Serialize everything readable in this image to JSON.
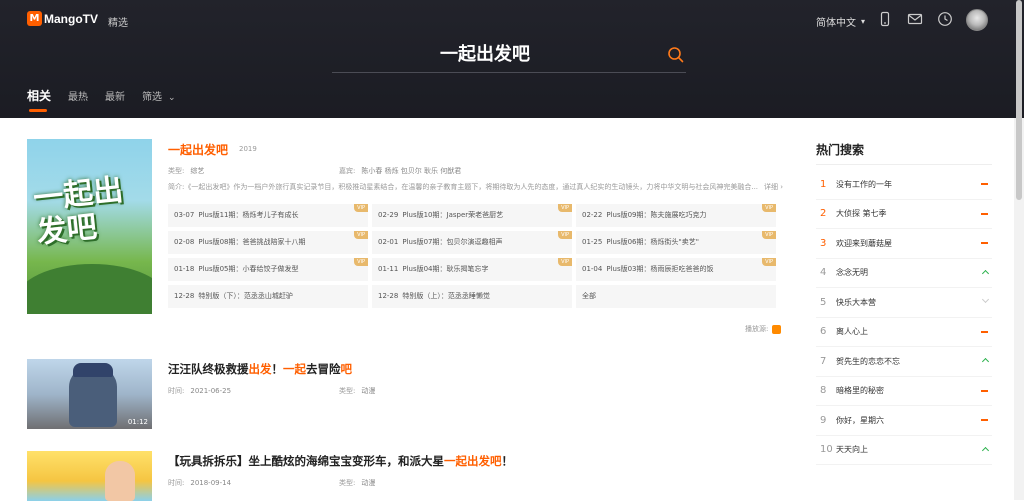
{
  "header": {
    "logo_text": "MangoTV",
    "logo_mark": "M",
    "nav_featured": "精选",
    "language": "简体中文",
    "search_query": "一起出发吧",
    "icons": [
      "phone-icon",
      "mail-icon",
      "clock-icon"
    ]
  },
  "tabs": [
    {
      "label": "相关"
    },
    {
      "label": "最热"
    },
    {
      "label": "最新"
    },
    {
      "label": "筛选"
    }
  ],
  "main_result": {
    "poster_text": "一起出发吧",
    "title": "一起出发吧",
    "year": "2019",
    "type_label": "类型:",
    "type_value": "综艺",
    "cast_label": "嘉宾:",
    "cast_value": "陈小春  杨烁  包贝尔  耿乐  何猷君",
    "desc_label": "简介:",
    "desc_value": "《一起出发吧》作为一档户外旅行真实记录节目，积极推动星素结合，在温馨的亲子教育主题下，将期待取为人先的态度，通过真人纪实的生动镜头，力将中华文明与社会风神完美融合...",
    "more": "详细",
    "vip_badge": "VIP",
    "episodes": [
      {
        "date": "03-07",
        "title": "Plus版11期：杨烁考儿子有成长",
        "vip": true
      },
      {
        "date": "02-29",
        "title": "Plus版10期：Jasper荣老爸厨艺",
        "vip": true
      },
      {
        "date": "02-22",
        "title": "Plus版09期：陈夫施展吃巧克力",
        "vip": true
      },
      {
        "date": "02-08",
        "title": "Plus版08期：爸爸挑战陪家十八期",
        "vip": true
      },
      {
        "date": "02-01",
        "title": "Plus版07期：包贝尔演逗趣相声",
        "vip": true
      },
      {
        "date": "01-25",
        "title": "Plus版06期：杨烁街头\"卖艺\"",
        "vip": true
      },
      {
        "date": "01-18",
        "title": "Plus版05期：小春给饺子做发型",
        "vip": true
      },
      {
        "date": "01-11",
        "title": "Plus版04期：耿乐揭笔忘字",
        "vip": true
      },
      {
        "date": "01-04",
        "title": "Plus版03期：杨雨辰拒吃爸爸的饭",
        "vip": true
      },
      {
        "date": "12-28",
        "title": "特别版（下）：范丞丞山城赶驴",
        "vip": false
      },
      {
        "date": "12-28",
        "title": "特别版（上）：范丞丞睡懒觉",
        "vip": false
      },
      {
        "date": "",
        "title": "全部",
        "vip": false
      }
    ],
    "play_source_label": "播放源:"
  },
  "results": [
    {
      "title_parts": [
        "汪汪队终极救援",
        "出发",
        "！",
        "一起",
        "去冒险",
        "吧"
      ],
      "time_label": "时间:",
      "time_value": "2021-06-25",
      "type_label": "类型:",
      "type_value": "动漫",
      "duration": "01:12"
    },
    {
      "title_parts": [
        "【玩具拆拆乐】坐上酷炫的海绵宝宝变形车，和派大星",
        "一起出发吧",
        "！"
      ],
      "time_label": "时间:",
      "time_value": "2018-09-14",
      "type_label": "类型:",
      "type_value": "动漫"
    }
  ],
  "hot_search": {
    "title": "热门搜索",
    "items": [
      {
        "rank": "1",
        "name": "没有工作的一年",
        "trend": "same"
      },
      {
        "rank": "2",
        "name": "大侦探 第七季",
        "trend": "same"
      },
      {
        "rank": "3",
        "name": "欢迎来到蘑菇屋",
        "trend": "same"
      },
      {
        "rank": "4",
        "name": "念念无明",
        "trend": "up"
      },
      {
        "rank": "5",
        "name": "快乐大本营",
        "trend": "down"
      },
      {
        "rank": "6",
        "name": "离人心上",
        "trend": "same"
      },
      {
        "rank": "7",
        "name": "贺先生的恋恋不忘",
        "trend": "up"
      },
      {
        "rank": "8",
        "name": "暗格里的秘密",
        "trend": "same"
      },
      {
        "rank": "9",
        "name": "你好，星期六",
        "trend": "same"
      },
      {
        "rank": "10",
        "name": "天天向上",
        "trend": "up"
      }
    ]
  },
  "colors": {
    "accent": "#ff5f00",
    "header_bg": "#1e1f26",
    "vip": "#e8b96c",
    "trend_up": "#2bb24c"
  }
}
